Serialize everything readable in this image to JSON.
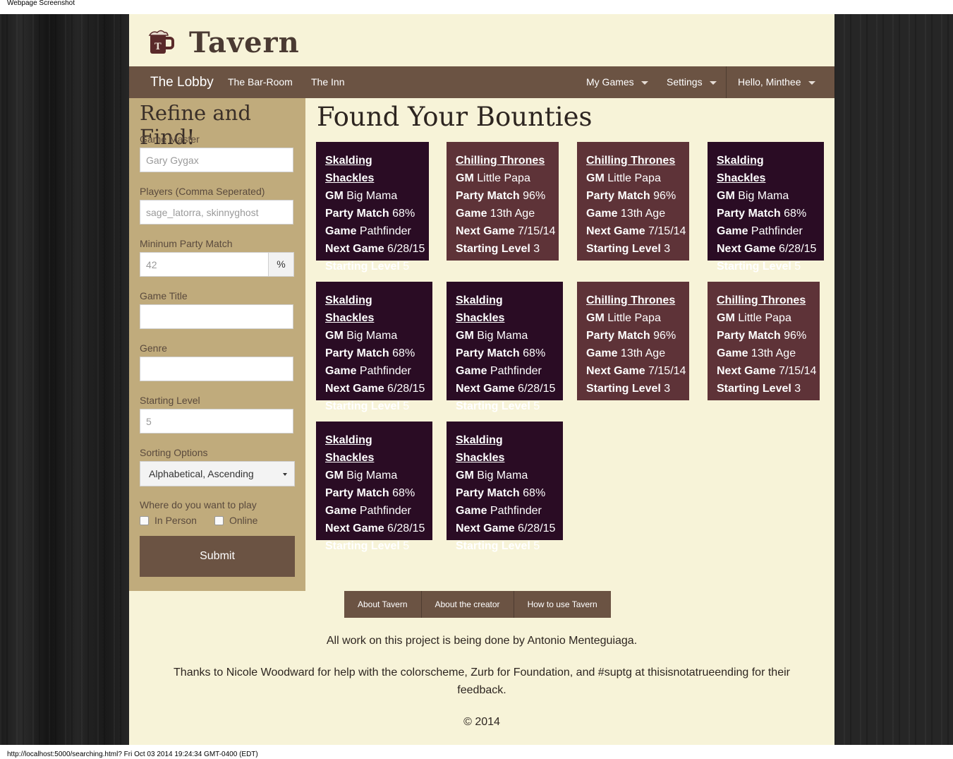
{
  "print": {
    "header": "Webpage Screenshot",
    "footer": "http://localhost:5000/searching.html? Fri Oct 03 2014 19:24:34 GMT-0400 (EDT)"
  },
  "brand": {
    "name": "Tavern",
    "icon": "beer-mug-icon"
  },
  "nav": {
    "home": "The Lobby",
    "bar_room": "The Bar-Room",
    "inn": "The Inn",
    "my_games": "My Games",
    "settings": "Settings",
    "user": "Hello, Minthee"
  },
  "sidebar": {
    "title": "Refine and Find!",
    "gm_label": "Game Master",
    "gm_placeholder": "Gary Gygax",
    "players_label": "Players (Comma Seperated)",
    "players_placeholder": "sage_latorra, skinnyghost",
    "match_label": "Mininum Party Match",
    "match_placeholder": "42",
    "match_postfix": "%",
    "title_label": "Game Title",
    "genre_label": "Genre",
    "level_label": "Starting Level",
    "level_placeholder": "5",
    "sort_label": "Sorting Options",
    "sort_value": "Alphabetical, Ascending",
    "where_label": "Where do you want to play",
    "in_person": "In Person",
    "online": "Online",
    "submit": "Submit"
  },
  "results": {
    "title": "Found Your Bounties",
    "keys": {
      "gm": "GM",
      "match": "Party Match",
      "game": "Game",
      "next": "Next Game",
      "level": "Starting Level"
    },
    "cards": [
      {
        "title": "Skalding Shackles",
        "gm": "Big Mama",
        "match": "68%",
        "game": "Pathfinder",
        "next": "6/28/15",
        "level": "5"
      },
      {
        "title": "Chilling Thrones",
        "gm": "Little Papa",
        "match": "96%",
        "game": "13th Age",
        "next": "7/15/14",
        "level": "3"
      },
      {
        "title": "Chilling Thrones",
        "gm": "Little Papa",
        "match": "96%",
        "game": "13th Age",
        "next": "7/15/14",
        "level": "3"
      },
      {
        "title": "Skalding Shackles",
        "gm": "Big Mama",
        "match": "68%",
        "game": "Pathfinder",
        "next": "6/28/15",
        "level": "5"
      },
      {
        "title": "Skalding Shackles",
        "gm": "Big Mama",
        "match": "68%",
        "game": "Pathfinder",
        "next": "6/28/15",
        "level": "5"
      },
      {
        "title": "Skalding Shackles",
        "gm": "Big Mama",
        "match": "68%",
        "game": "Pathfinder",
        "next": "6/28/15",
        "level": "5"
      },
      {
        "title": "Chilling Thrones",
        "gm": "Little Papa",
        "match": "96%",
        "game": "13th Age",
        "next": "7/15/14",
        "level": "3"
      },
      {
        "title": "Chilling Thrones",
        "gm": "Little Papa",
        "match": "96%",
        "game": "13th Age",
        "next": "7/15/14",
        "level": "3"
      },
      {
        "title": "Skalding Shackles",
        "gm": "Big Mama",
        "match": "68%",
        "game": "Pathfinder",
        "next": "6/28/15",
        "level": "5"
      },
      {
        "title": "Skalding Shackles",
        "gm": "Big Mama",
        "match": "68%",
        "game": "Pathfinder",
        "next": "6/28/15",
        "level": "5"
      }
    ]
  },
  "footer": {
    "links": [
      "About Tavern",
      "About the creator",
      "How to use Tavern"
    ],
    "credit": "All work on this project is being done by Antonio Menteguiaga.",
    "thanks": "Thanks to Nicole Woodward for help with the colorscheme, Zurb for Foundation, and #suptg at thisisnotatrueending for their feedback.",
    "copyright": "© 2014"
  },
  "colors": {
    "page_bg": "#f7f3d8",
    "topbar": "#6b5343",
    "sidebar": "#c0ab7c",
    "card_dark": "#2a0c24",
    "card_brown": "#5e3338"
  }
}
